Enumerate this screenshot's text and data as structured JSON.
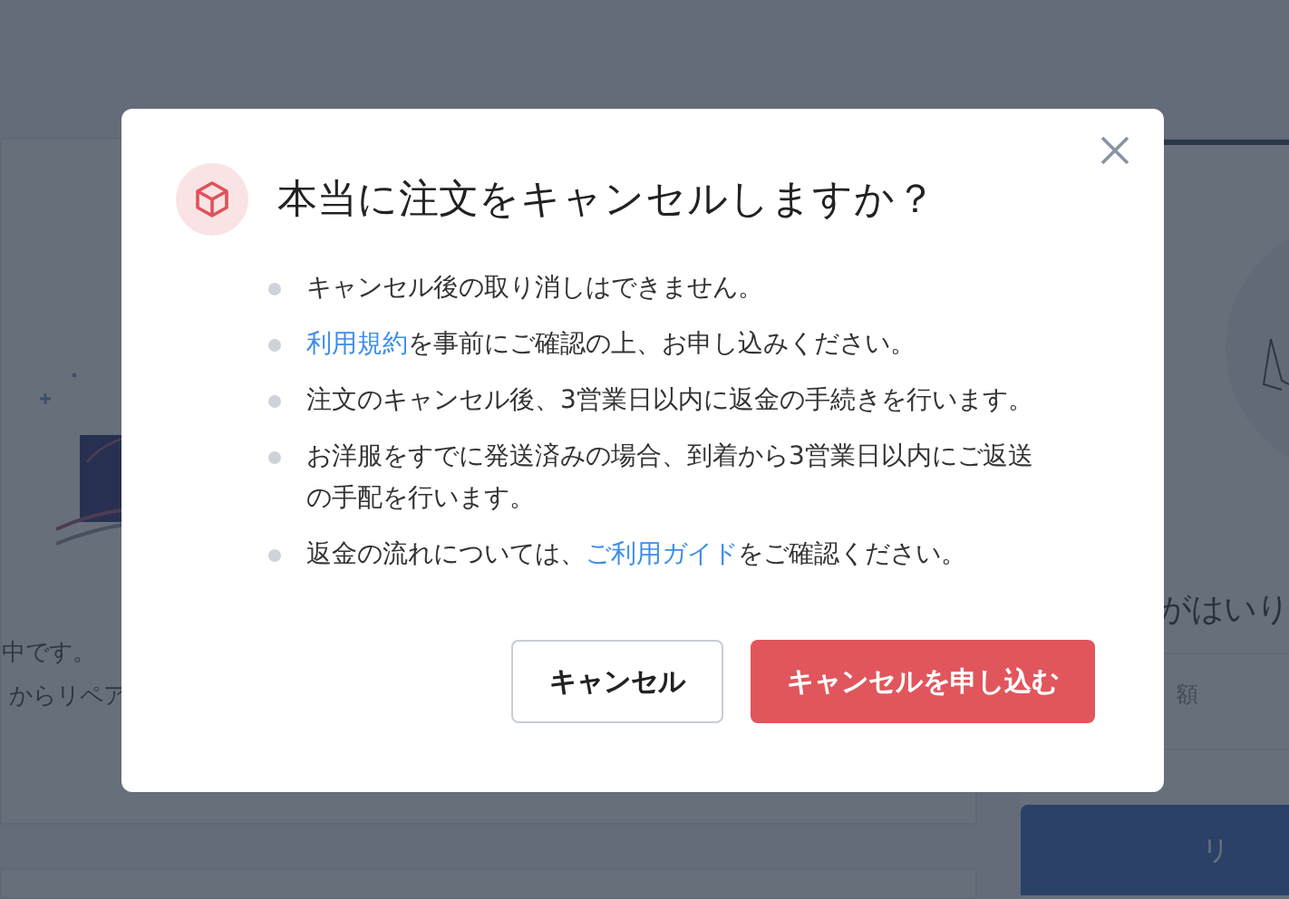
{
  "background": {
    "left_texts": [
      "中です。",
      "からリペア"
    ],
    "right_heading": "がはいり",
    "right_label": "額",
    "right_button": "リ"
  },
  "dialog": {
    "title": "本当に注文をキャンセルしますか？",
    "items": [
      {
        "parts": [
          {
            "kind": "text",
            "text": "キャンセル後の取り消しはできません。"
          }
        ]
      },
      {
        "parts": [
          {
            "kind": "link",
            "text": "利用規約"
          },
          {
            "kind": "text",
            "text": "を事前にご確認の上、お申し込みください。"
          }
        ]
      },
      {
        "parts": [
          {
            "kind": "text",
            "text": "注文のキャンセル後、3営業日以内に返金の手続きを行います。"
          }
        ]
      },
      {
        "parts": [
          {
            "kind": "text",
            "text": "お洋服をすでに発送済みの場合、到着から3営業日以内にご返送の手配を行います。"
          }
        ]
      },
      {
        "parts": [
          {
            "kind": "text",
            "text": "返金の流れについては、"
          },
          {
            "kind": "link",
            "text": "ご利用ガイド"
          },
          {
            "kind": "text",
            "text": "をご確認ください。"
          }
        ]
      }
    ],
    "buttons": [
      {
        "kind": "secondary",
        "label": "キャンセル"
      },
      {
        "kind": "primary",
        "label": "キャンセルを申し込む"
      }
    ]
  }
}
